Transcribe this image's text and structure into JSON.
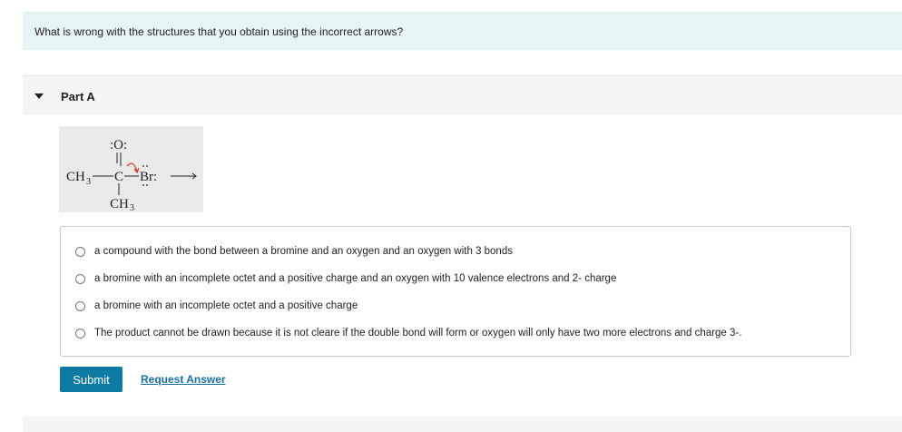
{
  "question": {
    "text": "What is wrong with the structures that you obtain using the incorrect arrows?"
  },
  "part": {
    "label": "Part A"
  },
  "structure": {
    "top_atom": ":O:",
    "left_group": "CH",
    "left_group_sub": "3",
    "center_atom": "C",
    "right_atom": "Br:",
    "bottom_group": "CH",
    "bottom_group_sub": "3",
    "arrow_color": "#d0352b"
  },
  "options": [
    "a compound with the bond between a bromine and an oxygen and an oxygen with 3 bonds",
    "a bromine with an incomplete octet and a positive charge and an oxygen with 10 valence electrons and 2- charge",
    "a bromine with an incomplete octet and a positive charge",
    "The product cannot be drawn because it is not cleare if the double bond will form or oxygen will only have two more electrons and charge 3-."
  ],
  "actions": {
    "submit_label": "Submit",
    "request_label": "Request Answer"
  },
  "colors": {
    "banner_bg": "#e6f6f6",
    "submit_bg": "#0d7aa4",
    "link": "#1a6fa8"
  }
}
